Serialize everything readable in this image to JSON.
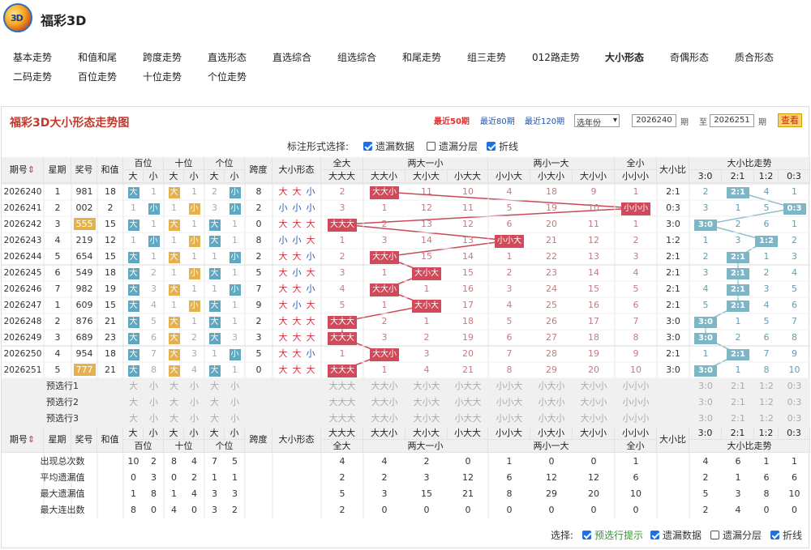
{
  "app": {
    "title": "福彩3D",
    "logo_text": "3D"
  },
  "nav": {
    "row1": [
      "基本走势",
      "和值和尾",
      "跨度走势",
      "直选形态",
      "直选综合",
      "组选综合",
      "和尾走势",
      "组三走势",
      "012路走势",
      "大小形态",
      "奇偶形态",
      "质合形态"
    ],
    "row2": [
      "二码走势",
      "百位走势",
      "十位走势",
      "个位走势"
    ],
    "active": "大小形态"
  },
  "panel": {
    "title": "福彩3D大小形态走势图",
    "links": [
      "最近50期",
      "最近80期",
      "最近120期"
    ],
    "year_select": "选年份",
    "from": "2026240",
    "to": "2026251",
    "qi": "期",
    "zhi": "至",
    "query": "查看",
    "mark_label": "标注形式选择:",
    "opt_missing": "遗漏数据",
    "opt_layer": "遗漏分层",
    "opt_line": "折线"
  },
  "headers": {
    "qihao": "期号",
    "week": "星期",
    "award": "奖号",
    "sum": "和值",
    "bai": "百位",
    "shi": "十位",
    "ge": "个位",
    "da": "大",
    "xiao": "小",
    "span": "跨度",
    "form": "大小形态",
    "g_all_big": "全大",
    "g_two_big": "两大一小",
    "g_two_small": "两小一大",
    "g_all_small": "全小",
    "forms": [
      "大大大",
      "大大小",
      "大小大",
      "小大大",
      "小小大",
      "小大小",
      "大小小",
      "小小小"
    ],
    "ratio": "大小比",
    "ratio_trend": "大小比走势",
    "ratios": [
      "3:0",
      "2:1",
      "1:2",
      "0:3"
    ]
  },
  "rows": [
    {
      "qi": "2026240",
      "wk": "1",
      "award": "981",
      "sum": "18",
      "bai": [
        "大",
        "1"
      ],
      "shi": [
        "大",
        "1"
      ],
      "ge": [
        "2",
        "小"
      ],
      "span": "8",
      "form": [
        "大",
        "大",
        "小"
      ],
      "f": [
        "2",
        "大大小",
        "11",
        "10",
        "4",
        "18",
        "9",
        "1"
      ],
      "ratio": "2:1",
      "r": [
        "2",
        "2:1",
        "4",
        "1"
      ]
    },
    {
      "qi": "2026241",
      "wk": "2",
      "award": "002",
      "sum": "2",
      "bai": [
        "1",
        "小"
      ],
      "shi": [
        "1",
        "小"
      ],
      "ge": [
        "3",
        "小"
      ],
      "span": "2",
      "form": [
        "小",
        "小",
        "小"
      ],
      "f": [
        "3",
        "1",
        "12",
        "11",
        "5",
        "19",
        "10",
        "小小小"
      ],
      "ratio": "0:3",
      "r": [
        "3",
        "1",
        "5",
        "0:3"
      ]
    },
    {
      "qi": "2026242",
      "wk": "3",
      "award": "555",
      "sum": "15",
      "bai": [
        "大",
        "1"
      ],
      "shi": [
        "大",
        "1"
      ],
      "ge": [
        "大",
        "1"
      ],
      "span": "0",
      "form": [
        "大",
        "大",
        "大"
      ],
      "f": [
        "大大大",
        "2",
        "13",
        "12",
        "6",
        "20",
        "11",
        "1"
      ],
      "ratio": "3:0",
      "r": [
        "3:0",
        "2",
        "6",
        "1"
      ]
    },
    {
      "qi": "2026243",
      "wk": "4",
      "award": "219",
      "sum": "12",
      "bai": [
        "1",
        "小"
      ],
      "shi": [
        "1",
        "小"
      ],
      "ge": [
        "大",
        "1"
      ],
      "span": "8",
      "form": [
        "小",
        "小",
        "大"
      ],
      "f": [
        "1",
        "3",
        "14",
        "13",
        "小小大",
        "21",
        "12",
        "2"
      ],
      "ratio": "1:2",
      "r": [
        "1",
        "3",
        "1:2",
        "2"
      ]
    },
    {
      "qi": "2026244",
      "wk": "5",
      "award": "654",
      "sum": "15",
      "bai": [
        "大",
        "1"
      ],
      "shi": [
        "大",
        "1"
      ],
      "ge": [
        "1",
        "小"
      ],
      "span": "2",
      "form": [
        "大",
        "大",
        "小"
      ],
      "f": [
        "2",
        "大大小",
        "15",
        "14",
        "1",
        "22",
        "13",
        "3"
      ],
      "ratio": "2:1",
      "r": [
        "2",
        "2:1",
        "1",
        "3"
      ]
    },
    {
      "qi": "2026245",
      "wk": "6",
      "award": "549",
      "sum": "18",
      "bai": [
        "大",
        "2"
      ],
      "shi": [
        "1",
        "小"
      ],
      "ge": [
        "大",
        "1"
      ],
      "span": "5",
      "form": [
        "大",
        "小",
        "大"
      ],
      "f": [
        "3",
        "1",
        "大小大",
        "15",
        "2",
        "23",
        "14",
        "4"
      ],
      "ratio": "2:1",
      "r": [
        "3",
        "2:1",
        "2",
        "4"
      ]
    },
    {
      "qi": "2026246",
      "wk": "7",
      "award": "982",
      "sum": "19",
      "bai": [
        "大",
        "3"
      ],
      "shi": [
        "大",
        "1"
      ],
      "ge": [
        "1",
        "小"
      ],
      "span": "7",
      "form": [
        "大",
        "大",
        "小"
      ],
      "f": [
        "4",
        "大大小",
        "1",
        "16",
        "3",
        "24",
        "15",
        "5"
      ],
      "ratio": "2:1",
      "r": [
        "4",
        "2:1",
        "3",
        "5"
      ]
    },
    {
      "qi": "2026247",
      "wk": "1",
      "award": "609",
      "sum": "15",
      "bai": [
        "大",
        "4"
      ],
      "shi": [
        "1",
        "小"
      ],
      "ge": [
        "大",
        "1"
      ],
      "span": "9",
      "form": [
        "大",
        "小",
        "大"
      ],
      "f": [
        "5",
        "1",
        "大小大",
        "17",
        "4",
        "25",
        "16",
        "6"
      ],
      "ratio": "2:1",
      "r": [
        "5",
        "2:1",
        "4",
        "6"
      ]
    },
    {
      "qi": "2026248",
      "wk": "2",
      "award": "876",
      "sum": "21",
      "bai": [
        "大",
        "5"
      ],
      "shi": [
        "大",
        "1"
      ],
      "ge": [
        "大",
        "1"
      ],
      "span": "2",
      "form": [
        "大",
        "大",
        "大"
      ],
      "f": [
        "大大大",
        "2",
        "1",
        "18",
        "5",
        "26",
        "17",
        "7"
      ],
      "ratio": "3:0",
      "r": [
        "3:0",
        "1",
        "5",
        "7"
      ]
    },
    {
      "qi": "2026249",
      "wk": "3",
      "award": "689",
      "sum": "23",
      "bai": [
        "大",
        "6"
      ],
      "shi": [
        "大",
        "2"
      ],
      "ge": [
        "大",
        "3"
      ],
      "span": "3",
      "form": [
        "大",
        "大",
        "大"
      ],
      "f": [
        "大大大",
        "3",
        "2",
        "19",
        "6",
        "27",
        "18",
        "8"
      ],
      "ratio": "3:0",
      "r": [
        "3:0",
        "2",
        "6",
        "8"
      ]
    },
    {
      "qi": "2026250",
      "wk": "4",
      "award": "954",
      "sum": "18",
      "bai": [
        "大",
        "7"
      ],
      "shi": [
        "大",
        "3"
      ],
      "ge": [
        "1",
        "小"
      ],
      "span": "5",
      "form": [
        "大",
        "大",
        "小"
      ],
      "f": [
        "1",
        "大大小",
        "3",
        "20",
        "7",
        "28",
        "19",
        "9"
      ],
      "ratio": "2:1",
      "r": [
        "1",
        "2:1",
        "7",
        "9"
      ]
    },
    {
      "qi": "2026251",
      "wk": "5",
      "award": "777",
      "sum": "21",
      "bai": [
        "大",
        "8"
      ],
      "shi": [
        "大",
        "4"
      ],
      "ge": [
        "大",
        "1"
      ],
      "span": "0",
      "form": [
        "大",
        "大",
        "大"
      ],
      "f": [
        "大大大",
        "1",
        "4",
        "21",
        "8",
        "29",
        "20",
        "10"
      ],
      "ratio": "3:0",
      "r": [
        "3:0",
        "1",
        "8",
        "10"
      ]
    }
  ],
  "predict_rows": [
    "预选行1",
    "预选行2",
    "预选行3"
  ],
  "stats": [
    {
      "label": "出现总次数",
      "pos": [
        "10",
        "2",
        "8",
        "4",
        "7",
        "5"
      ],
      "f": [
        "4",
        "4",
        "2",
        "0",
        "1",
        "0",
        "0",
        "1"
      ],
      "r": [
        "4",
        "6",
        "1",
        "1"
      ]
    },
    {
      "label": "平均遗漏值",
      "pos": [
        "0",
        "3",
        "0",
        "2",
        "1",
        "1"
      ],
      "f": [
        "2",
        "2",
        "3",
        "12",
        "6",
        "12",
        "12",
        "6"
      ],
      "r": [
        "2",
        "1",
        "6",
        "6"
      ]
    },
    {
      "label": "最大遗漏值",
      "pos": [
        "1",
        "8",
        "1",
        "4",
        "3",
        "3"
      ],
      "f": [
        "5",
        "3",
        "15",
        "21",
        "8",
        "29",
        "20",
        "10"
      ],
      "r": [
        "5",
        "3",
        "8",
        "10"
      ]
    },
    {
      "label": "最大连出数",
      "pos": [
        "8",
        "0",
        "4",
        "0",
        "3",
        "2"
      ],
      "f": [
        "2",
        "0",
        "0",
        "0",
        "0",
        "0",
        "0",
        "0"
      ],
      "r": [
        "2",
        "4",
        "0",
        "0"
      ]
    }
  ],
  "footer": {
    "label": "选择:",
    "opt_hint": "预选行提示",
    "opt_missing": "遗漏数据",
    "opt_layer": "遗漏分层",
    "opt_line": "折线"
  }
}
